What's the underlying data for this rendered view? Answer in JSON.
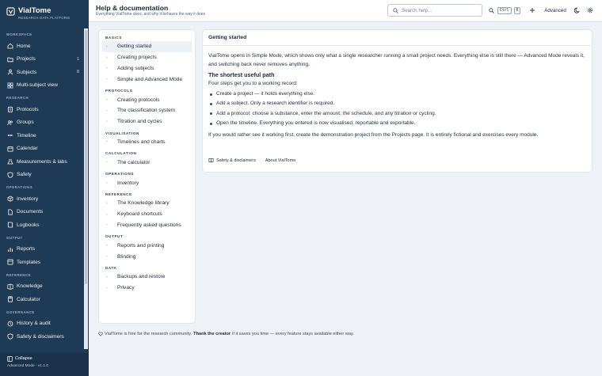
{
  "brand": {
    "name": "VialTome",
    "subtitle": "Research Data Platform"
  },
  "sidebar": {
    "sections": [
      {
        "title": "Workspace",
        "items": [
          {
            "label": "Home",
            "icon": "home-icon",
            "count": ""
          },
          {
            "label": "Projects",
            "icon": "folder-icon",
            "count": "1"
          },
          {
            "label": "Subjects",
            "icon": "user-icon",
            "count": "8"
          },
          {
            "label": "Multi-subject view",
            "icon": "grid-icon",
            "count": ""
          }
        ]
      },
      {
        "title": "Research",
        "items": [
          {
            "label": "Protocols",
            "icon": "clipboard-icon",
            "count": ""
          },
          {
            "label": "Groups",
            "icon": "users-icon",
            "count": ""
          },
          {
            "label": "Timeline",
            "icon": "timeline-icon",
            "count": ""
          },
          {
            "label": "Calendar",
            "icon": "calendar-icon",
            "count": ""
          },
          {
            "label": "Measurements & labs",
            "icon": "flask-icon",
            "count": ""
          },
          {
            "label": "Safety",
            "icon": "shield-icon",
            "count": ""
          }
        ]
      },
      {
        "title": "Operations",
        "items": [
          {
            "label": "Inventory",
            "icon": "box-icon",
            "count": ""
          },
          {
            "label": "Documents",
            "icon": "document-icon",
            "count": ""
          },
          {
            "label": "Logbooks",
            "icon": "book-icon",
            "count": ""
          }
        ]
      },
      {
        "title": "Output",
        "items": [
          {
            "label": "Reports",
            "icon": "chart-icon",
            "count": ""
          },
          {
            "label": "Templates",
            "icon": "template-icon",
            "count": ""
          }
        ]
      },
      {
        "title": "Reference",
        "items": [
          {
            "label": "Knowledge",
            "icon": "knowledge-icon",
            "count": ""
          },
          {
            "label": "Calculator",
            "icon": "calculator-icon",
            "count": ""
          }
        ]
      },
      {
        "title": "Governance",
        "items": [
          {
            "label": "History & audit",
            "icon": "history-icon",
            "count": ""
          },
          {
            "label": "Safety & disclaimers",
            "icon": "shield-icon",
            "count": ""
          }
        ]
      }
    ],
    "collapse_label": "Collapse",
    "version": "Advanced Mode · v1.1.0"
  },
  "header": {
    "title": "Help & documentation",
    "subtitle": "Everything VialTome does, and why it behaves the way it does",
    "search_placeholder": "Search help...",
    "kbd_ctrl": "Ctrl",
    "kbd_key": "K",
    "mode_label": "Advanced"
  },
  "help_nav": {
    "sections": [
      {
        "title": "Basics",
        "items": [
          "Getting started",
          "Creating projects",
          "Adding subjects",
          "Simple and Advanced Mode"
        ]
      },
      {
        "title": "Protocols",
        "items": [
          "Creating protocols",
          "The classification system",
          "Titration and cycles"
        ]
      },
      {
        "title": "Visualisation",
        "items": [
          "Timelines and charts"
        ]
      },
      {
        "title": "Calculation",
        "items": [
          "The calculator"
        ]
      },
      {
        "title": "Operations",
        "items": [
          "Inventory"
        ]
      },
      {
        "title": "Reference",
        "items": [
          "The Knowledge library",
          "Keyboard shortcuts",
          "Frequently asked questions"
        ]
      },
      {
        "title": "Output",
        "items": [
          "Reports and printing",
          "Blinding"
        ]
      },
      {
        "title": "Data",
        "items": [
          "Backups and restore",
          "Privacy"
        ]
      }
    ]
  },
  "article": {
    "title": "Getting started",
    "intro": "VialTome opens in Simple Mode, which shows only what a single researcher running a small project needs. Everything else is still there — Advanced Mode reveals it, and switching back never removes anything.",
    "path_heading": "The shortest useful path",
    "steps_lead": "Four steps get you to a working record:",
    "steps": [
      "Create a project — it holds everything else.",
      "Add a subject. Only a research identifier is required.",
      "Add a protocol: choose a substance, enter the amount, the schedule, and any titration or cycling.",
      "Open the timeline. Everything you entered is now visualised, reportable and exportable."
    ],
    "outro": "If you would rather see it working first, create the demonstration project from the Projects page. It is entirely fictional and exercises every module.",
    "link_safety": "Safety & disclaimers",
    "link_about": "About VialTome"
  },
  "footer": {
    "prefix": "VialTome is free for the research community.",
    "thanks": "Thank the creator",
    "suffix": "if it saves you time — every feature stays available either way."
  }
}
